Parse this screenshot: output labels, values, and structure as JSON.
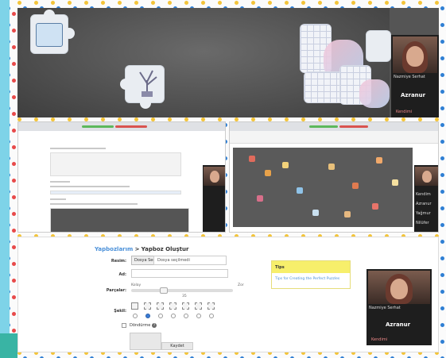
{
  "top_panel": {
    "video": {
      "small_label": "Nazmiye Serhat",
      "name": "Azranur",
      "footer_label": "Kendimi"
    }
  },
  "mid_right_panel": {
    "side_labels": [
      "Kendim",
      "Azranur",
      "Yağmur",
      "Nilüfer"
    ]
  },
  "bottom_panel": {
    "breadcrumb": {
      "link": "Yapbozlarım",
      "separator": ">",
      "current": "Yapboz Oluştur"
    },
    "form": {
      "image_label": "Resim:",
      "file_button": "Dosya Seç",
      "file_status": "Dosya seçilmedi",
      "name_label": "Ad:",
      "pieces_label": "Parçalar:",
      "difficulty_easy": "Kolay",
      "difficulty_hard": "Zor",
      "pieces_value": "35",
      "shape_label": "Şekil:",
      "rotate_label": "Döndürme",
      "save_label": "Kaydet"
    },
    "tips": {
      "title": "Tips",
      "link": "Tips for Creating the Perfect Puzzles"
    },
    "video": {
      "small_label": "Nazmiye Serhat",
      "name": "Azranur",
      "footer_label": "Kendimi"
    }
  },
  "colors": {
    "dot_blue": "#2f7fd4",
    "dot_red": "#e84a4a",
    "dot_yellow": "#f3c43a",
    "link_blue": "#4a90d9",
    "tips_yellow": "#f7ef6b",
    "radio_selected": "#3a7bd5"
  }
}
